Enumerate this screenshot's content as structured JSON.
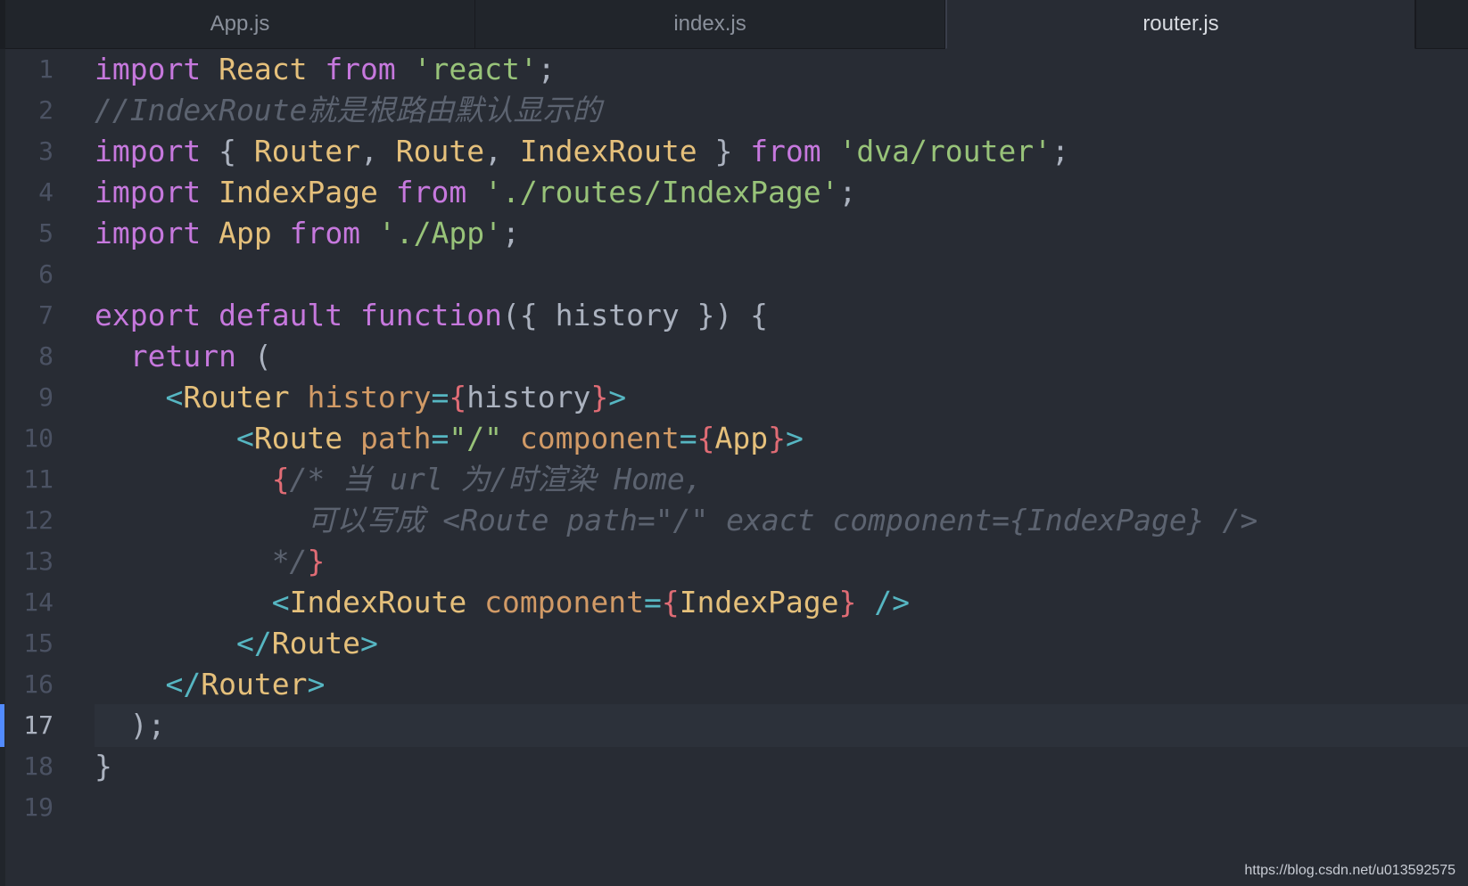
{
  "tabs": [
    {
      "label": "App.js",
      "active": false
    },
    {
      "label": "index.js",
      "active": false
    },
    {
      "label": "router.js",
      "active": true
    }
  ],
  "editor": {
    "cursor_line": 17,
    "lines": [
      {
        "n": "1"
      },
      {
        "n": "2"
      },
      {
        "n": "3"
      },
      {
        "n": "4"
      },
      {
        "n": "5"
      },
      {
        "n": "6"
      },
      {
        "n": "7"
      },
      {
        "n": "8"
      },
      {
        "n": "9"
      },
      {
        "n": "10"
      },
      {
        "n": "11"
      },
      {
        "n": "12"
      },
      {
        "n": "13"
      },
      {
        "n": "14"
      },
      {
        "n": "15"
      },
      {
        "n": "16"
      },
      {
        "n": "17"
      },
      {
        "n": "18"
      },
      {
        "n": "19"
      }
    ],
    "tokens": {
      "l1": [
        "import",
        " ",
        "React",
        " ",
        "from",
        " ",
        "'react'",
        ";"
      ],
      "l2": [
        "//IndexRoute就是根路由默认显示的"
      ],
      "l3": [
        "import",
        " { ",
        "Router",
        ", ",
        "Route",
        ", ",
        "IndexRoute",
        " } ",
        "from",
        " ",
        "'dva/router'",
        ";"
      ],
      "l4": [
        "import",
        " ",
        "IndexPage",
        " ",
        "from",
        " ",
        "'./routes/IndexPage'",
        ";"
      ],
      "l5": [
        "import",
        " ",
        "App",
        " ",
        "from",
        " ",
        "'./App'",
        ";"
      ],
      "l7": [
        "export",
        " ",
        "default",
        " ",
        "function",
        "({ ",
        "history",
        " }) {"
      ],
      "l8": [
        "  ",
        "return",
        " ("
      ],
      "l9": [
        "    ",
        "<",
        "Router",
        " ",
        "history",
        "=",
        "{",
        "history",
        "}",
        ">"
      ],
      "l10": [
        "        ",
        "<",
        "Route",
        " ",
        "path",
        "=",
        "\"/\"",
        " ",
        "component",
        "=",
        "{",
        "App",
        "}",
        ">"
      ],
      "l11": [
        "          ",
        "{",
        "/* 当 url 为/时渲染 Home,"
      ],
      "l12": [
        "            可以写成 <Route path=\"/\" exact component={IndexPage} />"
      ],
      "l13": [
        "          ",
        "*/",
        "}"
      ],
      "l14": [
        "          ",
        "<",
        "IndexRoute",
        " ",
        "component",
        "=",
        "{",
        "IndexPage",
        "}",
        " />"
      ],
      "l15": [
        "        ",
        "</",
        "Route",
        ">"
      ],
      "l16": [
        "    ",
        "</",
        "Router",
        ">"
      ],
      "l17": [
        "  );"
      ],
      "l18": [
        "}"
      ]
    }
  },
  "watermark": "https://blog.csdn.net/u013592575",
  "colors": {
    "background": "#282c34",
    "keyword": "#c678dd",
    "identifier": "#e5c07b",
    "string": "#98c379",
    "comment": "#5c6370",
    "attribute": "#d19a66",
    "bracket": "#56b6c2",
    "brace": "#e06c75",
    "cursor_marker": "#528bff"
  }
}
